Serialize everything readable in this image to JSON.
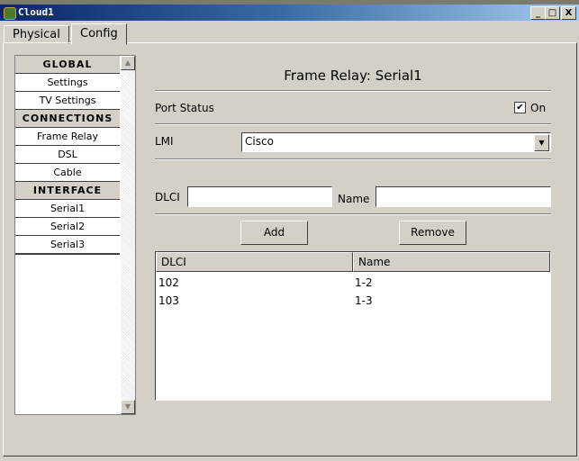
{
  "window": {
    "title": "Cloud1",
    "min": "_",
    "max": "□",
    "close": "X"
  },
  "tabs": [
    {
      "label": "Physical",
      "active": false
    },
    {
      "label": "Config",
      "active": true
    }
  ],
  "sidebar": {
    "items": [
      {
        "label": "GLOBAL",
        "header": true
      },
      {
        "label": "Settings"
      },
      {
        "label": "TV Settings"
      },
      {
        "label": "CONNECTIONS",
        "header": true
      },
      {
        "label": "Frame Relay"
      },
      {
        "label": "DSL"
      },
      {
        "label": "Cable"
      },
      {
        "label": "INTERFACE",
        "header": true
      },
      {
        "label": "Serial1"
      },
      {
        "label": "Serial2"
      },
      {
        "label": "Serial3"
      }
    ]
  },
  "main": {
    "title": "Frame Relay: Serial1",
    "port_status_label": "Port Status",
    "port_status_on": "On",
    "port_status_checked": true,
    "lmi_label": "LMI",
    "lmi_value": "Cisco",
    "dlci_label": "DLCI",
    "dlci_value": "",
    "name_label": "Name",
    "name_value": "",
    "add_label": "Add",
    "remove_label": "Remove",
    "table": {
      "columns": [
        "DLCI",
        "Name"
      ],
      "rows": [
        [
          "102",
          "1-2"
        ],
        [
          "103",
          "1-3"
        ]
      ]
    }
  }
}
